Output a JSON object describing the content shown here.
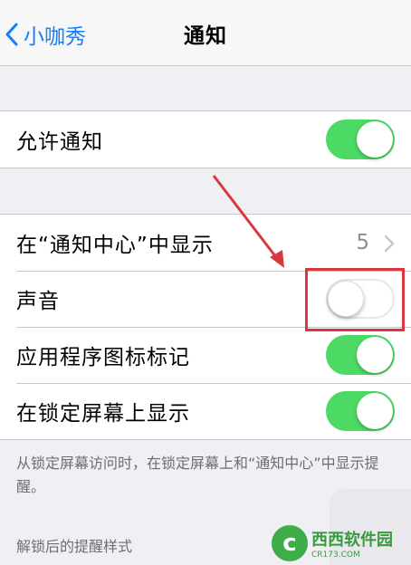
{
  "nav": {
    "back_label": "小咖秀",
    "title": "通知"
  },
  "allow_section": {
    "label": "允许通知",
    "on": true
  },
  "settings": [
    {
      "label": "在“通知中心”中显示",
      "value": "5"
    },
    {
      "label": "声音",
      "on": false
    },
    {
      "label": "应用程序图标标记",
      "on": true
    },
    {
      "label": "在锁定屏幕上显示",
      "on": true
    }
  ],
  "footer_note": "从锁定屏幕访问时，在锁定屏幕上和“通知中心”中显示提醒。",
  "section_header": "解锁后的提醒样式",
  "watermark": {
    "brand": "西西软件园",
    "url": "CR173.COM"
  },
  "colors": {
    "toggle_on": "#4cd964",
    "link": "#157efb",
    "highlight": "#d9393e"
  }
}
